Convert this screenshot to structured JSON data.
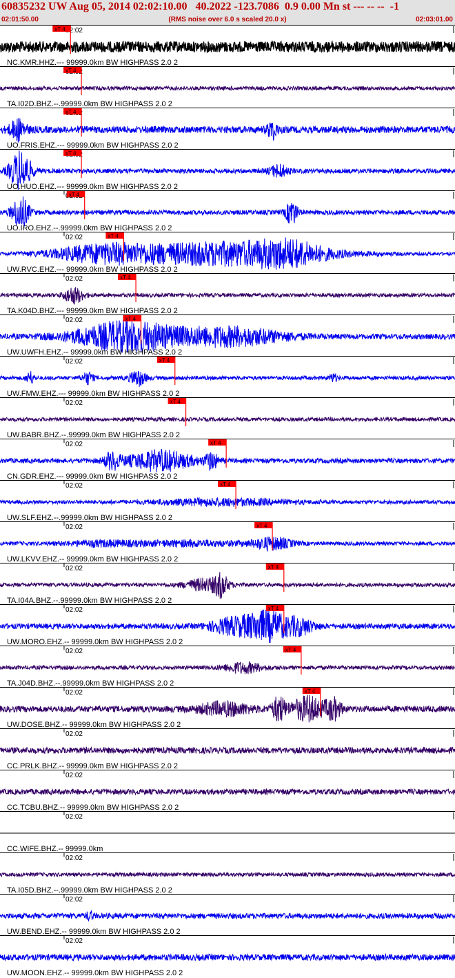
{
  "header": {
    "title": "60835232 UW Aug 05, 2014 02:02:10.00   40.2022 -123.7086  0.9 0.00 Mn st --- -- --  -1",
    "start_time": "02:01:50.00",
    "subtitle": "(RMS noise over 6.0 s scaled 20.0 x)",
    "end_time": "02:03:01.00"
  },
  "chart_data": {
    "type": "seismogram",
    "time_start": "02:01:50.00",
    "time_end": "02:03:01.00",
    "tick_label": "02:02",
    "pick_label": "xT 4",
    "colors": {
      "pick": "#ff0000",
      "blue_trace": "#0000ee",
      "dark_trace": "#330066",
      "black_trace": "#000000",
      "line": "#000000"
    },
    "traces": [
      {
        "label": "NC.KMR.HHZ.--- 99999.0km BW  HIGHPASS  2.0  2",
        "color": "black",
        "amp": 0.28,
        "pick_s": 1.0,
        "bursts": []
      },
      {
        "label": "TA.I02D.BHZ.--.99999.0km BW  HIGHPASS  2.0  2",
        "color": "dark",
        "amp": 0.1,
        "pick_s": 2.7,
        "bursts": []
      },
      {
        "label": "UO.FRIS.EHZ.--- 99999.0km BW  HIGHPASS  2.0  2",
        "color": "blue",
        "amp": 0.18,
        "pick_s": 2.7,
        "bursts": [
          [
            2.8,
            1.2,
            0.5
          ],
          [
            42.5,
            0.8,
            0.4
          ]
        ]
      },
      {
        "label": "UO.HUO.EHZ.--- 99999.0km BW  HIGHPASS  2.0  2",
        "color": "blue",
        "amp": 0.12,
        "pick_s": 2.7,
        "bursts": [
          [
            -2.7,
            0.6,
            0.3
          ],
          [
            3.2,
            1.6,
            1.0
          ],
          [
            43.5,
            1.4,
            0.3
          ]
        ]
      },
      {
        "label": "UO.IRO.EHZ.--.99999.0km BW  HIGHPASS  2.0  2",
        "color": "blue",
        "amp": 0.12,
        "pick_s": 3.2,
        "bursts": [
          [
            3.2,
            1.3,
            0.8
          ],
          [
            45.5,
            0.9,
            0.6
          ]
        ]
      },
      {
        "label": "UW.RVC.EHZ.--- 99999.0km BW  HIGHPASS  2.0  2",
        "color": "blue",
        "amp": 0.08,
        "pick_s": 9.3,
        "bursts": [
          [
            16.0,
            8.0,
            0.4
          ],
          [
            35.0,
            15.0,
            0.6
          ],
          [
            45.0,
            5.0,
            0.4
          ]
        ]
      },
      {
        "label": "TA.K04D.BHZ.--- 99999.0km BW  HIGHPASS  2.0  2",
        "color": "dark",
        "amp": 0.1,
        "pick_s": 11.2,
        "bursts": [
          [
            11.5,
            1.5,
            0.4
          ]
        ]
      },
      {
        "label": "UW.UWFH.EHZ.-- 99999.0km BW  HIGHPASS  2.0  2",
        "color": "blue",
        "amp": 0.14,
        "pick_s": 12.0,
        "bursts": [
          [
            20.0,
            8.0,
            0.75
          ],
          [
            36.0,
            8.0,
            0.45
          ]
        ]
      },
      {
        "label": "UW.FMW.EHZ.--- 99999.0km BW  HIGHPASS  2.0  2",
        "color": "blue",
        "amp": 0.1,
        "pick_s": 17.3,
        "bursts": [
          [
            -7.3,
            0.8,
            0.3
          ],
          [
            -1.3,
            0.6,
            0.3
          ],
          [
            4.7,
            0.6,
            0.3
          ],
          [
            13.7,
            0.8,
            0.3
          ],
          [
            21.5,
            1.2,
            0.4
          ],
          [
            52.0,
            0.6,
            0.2
          ]
        ]
      },
      {
        "label": "UW.BABR.BHZ.--.99999.0km BW  HIGHPASS  2.0  2",
        "color": "dark",
        "amp": 0.1,
        "pick_s": 19.0,
        "bursts": []
      },
      {
        "label": "CN.GDR.EHZ.--- 99999.0km BW  HIGHPASS  2.0  2",
        "color": "blue",
        "amp": 0.12,
        "pick_s": 25.3,
        "bursts": [
          [
            17.5,
            1.2,
            0.4
          ],
          [
            25.0,
            5.0,
            0.5
          ],
          [
            33.0,
            1.0,
            0.4
          ]
        ]
      },
      {
        "label": "UW.SLF.EHZ.--.99999.0km BW  HIGHPASS  2.0  2",
        "color": "blue",
        "amp": 0.1,
        "pick_s": 26.8,
        "bursts": [
          [
            35.0,
            10.0,
            0.15
          ]
        ]
      },
      {
        "label": "UW.LKVV.EHZ.-- 99999.0km BW  HIGHPASS  2.0  2",
        "color": "blue",
        "amp": 0.1,
        "pick_s": 32.5,
        "bursts": [
          [
            16.0,
            6.0,
            0.12
          ],
          [
            30.0,
            8.0,
            0.12
          ],
          [
            42.5,
            3.0,
            0.3
          ]
        ]
      },
      {
        "label": "TA.I04A.BHZ.--.99999.0km BW  HIGHPASS  2.0  2",
        "color": "dark",
        "amp": 0.1,
        "pick_s": 34.3,
        "bursts": [
          [
            32.0,
            3.0,
            0.3
          ],
          [
            34.5,
            1.0,
            0.5
          ]
        ]
      },
      {
        "label": "UW.MORO.EHZ.-- 99999.0km BW  HIGHPASS  2.0  2",
        "color": "blue",
        "amp": 0.14,
        "pick_s": 34.3,
        "bursts": [
          [
            35.5,
            3.0,
            0.3
          ],
          [
            41.5,
            4.0,
            0.75
          ],
          [
            47.0,
            2.0,
            0.3
          ]
        ]
      },
      {
        "label": "TA.J04D.BHZ.--.99999.0km BW  HIGHPASS  2.0  2",
        "color": "dark",
        "amp": 0.1,
        "pick_s": 37.0,
        "bursts": [
          [
            38.0,
            3.0,
            0.25
          ]
        ]
      },
      {
        "label": "UW.DOSE.BHZ.-- 99999.0km BW  HIGHPASS  2.0  2",
        "color": "dark",
        "amp": 0.16,
        "pick_s": 40.0,
        "bursts": [
          [
            35.0,
            4.0,
            0.3
          ],
          [
            43.5,
            1.0,
            0.6
          ],
          [
            48.0,
            2.5,
            0.6
          ],
          [
            52.0,
            1.2,
            0.5
          ]
        ]
      },
      {
        "label": "CC.PRLK.BHZ.-- 99999.0km BW  HIGHPASS  2.0  2",
        "color": "dark",
        "amp": 0.16,
        "pick_s": null,
        "bursts": []
      },
      {
        "label": "CC.TCBU.BHZ.-- 99999.0km BW  HIGHPASS  2.0  2",
        "color": "dark",
        "amp": 0.14,
        "pick_s": null,
        "bursts": []
      },
      {
        "label": "CC.WIFE.BHZ.-- 99999.0km",
        "color": "flat",
        "amp": 0.0,
        "pick_s": null,
        "bursts": []
      },
      {
        "label": "TA.I05D.BHZ.--.99999.0km BW  HIGHPASS  2.0  2",
        "color": "dark",
        "amp": 0.1,
        "pick_s": null,
        "bursts": []
      },
      {
        "label": "UW.BEND.EHZ.-- 99999.0km BW  HIGHPASS  2.0  2",
        "color": "blue",
        "amp": 0.14,
        "pick_s": null,
        "bursts": [
          [
            14.0,
            0.5,
            0.2
          ]
        ]
      },
      {
        "label": "UW.MOON.EHZ.-- 99999.0km BW  HIGHPASS  2.0  2",
        "color": "blue",
        "amp": 0.16,
        "pick_s": null,
        "bursts": []
      }
    ]
  }
}
